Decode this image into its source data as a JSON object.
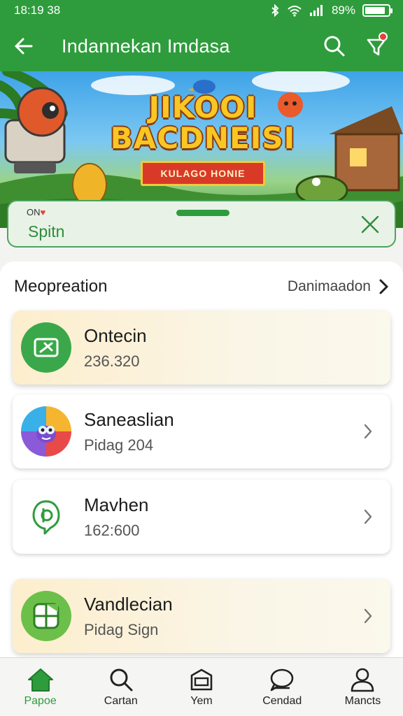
{
  "status_bar": {
    "time": "18:19 38",
    "battery": "89%",
    "battery_level": 0.89
  },
  "app_bar": {
    "title": "Indannekan Imdasa",
    "back_icon": "arrow-left-icon",
    "search_icon": "search-icon",
    "notification_icon": "notification-icon"
  },
  "banner": {
    "title_line1": "JIKOOI",
    "title_line2": "BACDNEISI",
    "ribbon": "KULAGO HONIE"
  },
  "search_sheet": {
    "small_label": "ON",
    "value": "Spitn"
  },
  "section": {
    "title": "Meopreation",
    "link_label": "Danimaadon"
  },
  "cards": [
    {
      "title": "Ontecin",
      "subtitle": "236.320",
      "icon": "ticket-icon"
    },
    {
      "title": "Saneaslian",
      "subtitle": "Pidag 204",
      "icon": "mascot-icon"
    },
    {
      "title": "Mavhen",
      "subtitle": "162:600",
      "icon": "chat-pin-icon"
    },
    {
      "title": "Vandlecian",
      "subtitle": "Pidag Sign",
      "icon": "grid-doc-icon"
    }
  ],
  "bottom_nav": [
    {
      "label": "Papoe",
      "icon": "home-icon",
      "active": true
    },
    {
      "label": "Cartan",
      "icon": "search-icon",
      "active": false
    },
    {
      "label": "Yem",
      "icon": "box-icon",
      "active": false
    },
    {
      "label": "Cendad",
      "icon": "chat-icon",
      "active": false
    },
    {
      "label": "Mancts",
      "icon": "user-icon",
      "active": false
    }
  ],
  "colors": {
    "primary": "#2e9c3c",
    "accent_red": "#e5413a",
    "card_highlight": "#fdeecd"
  }
}
